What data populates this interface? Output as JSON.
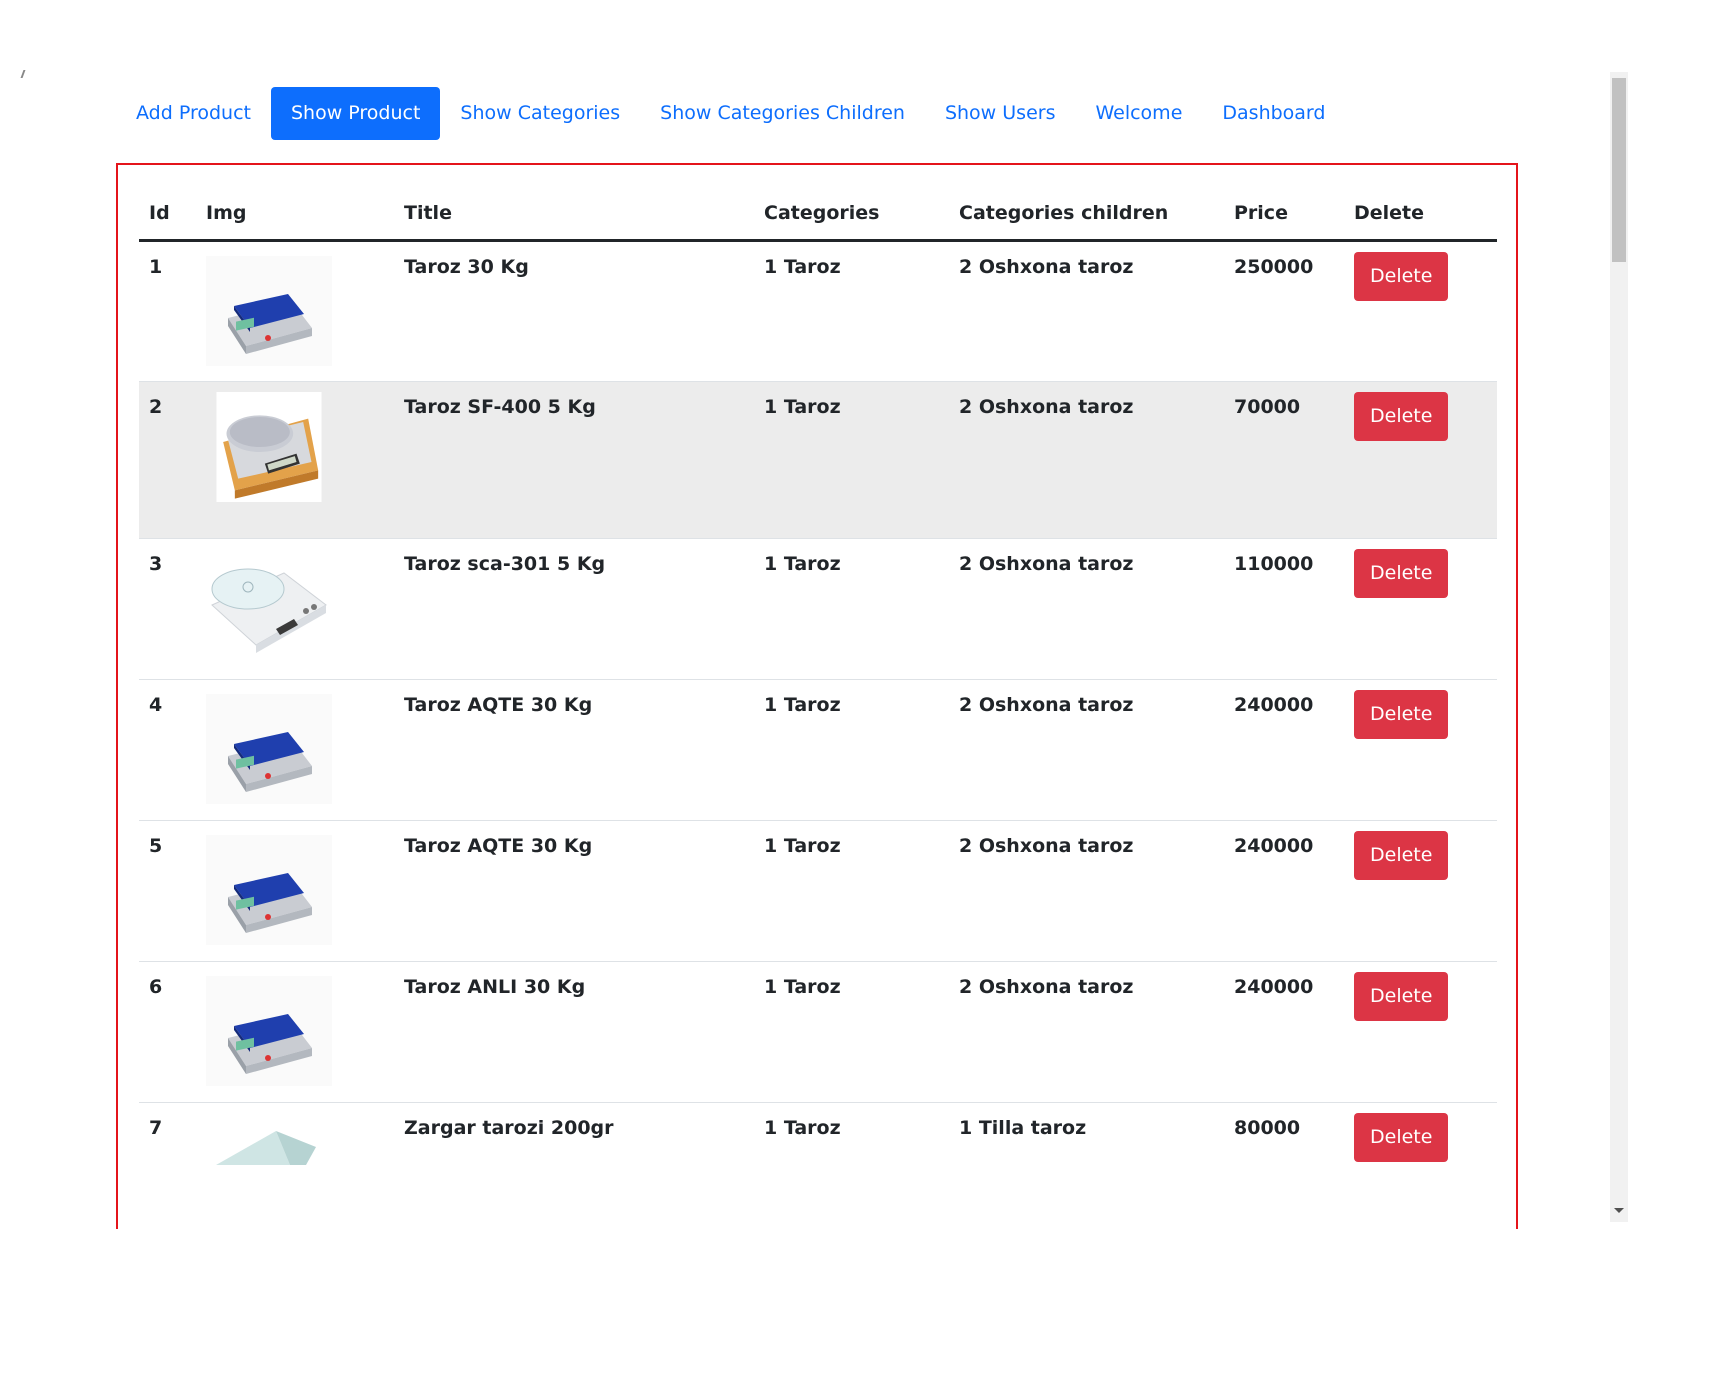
{
  "nav": {
    "items": [
      {
        "label": "Add Product",
        "active": false
      },
      {
        "label": "Show Product",
        "active": true
      },
      {
        "label": "Show Categories",
        "active": false
      },
      {
        "label": "Show Categories Children",
        "active": false
      },
      {
        "label": "Show Users",
        "active": false
      },
      {
        "label": "Welcome",
        "active": false
      },
      {
        "label": "Dashboard",
        "active": false
      }
    ]
  },
  "table": {
    "headers": {
      "id": "Id",
      "img": "Img",
      "title": "Title",
      "categories": "Categories",
      "children": "Categories children",
      "price": "Price",
      "delete": "Delete"
    },
    "rows": [
      {
        "id": "1",
        "img": "blue-platform-scale",
        "title": "Taroz 30 Kg",
        "categories": "1 Taroz",
        "children": "2 Oshxona taroz",
        "price": "250000",
        "action": "Delete"
      },
      {
        "id": "2",
        "img": "silver-kitchen-scale",
        "title": "Taroz SF-400 5 Kg",
        "categories": "1 Taroz",
        "children": "2 Oshxona taroz",
        "price": "70000",
        "action": "Delete"
      },
      {
        "id": "3",
        "img": "white-glass-scale",
        "title": "Taroz sca-301 5 Kg",
        "categories": "1 Taroz",
        "children": "2 Oshxona taroz",
        "price": "110000",
        "action": "Delete"
      },
      {
        "id": "4",
        "img": "blue-platform-scale",
        "title": "Taroz AQTE 30 Kg",
        "categories": "1 Taroz",
        "children": "2 Oshxona taroz",
        "price": "240000",
        "action": "Delete"
      },
      {
        "id": "5",
        "img": "blue-platform-scale",
        "title": "Taroz AQTE 30 Kg",
        "categories": "1 Taroz",
        "children": "2 Oshxona taroz",
        "price": "240000",
        "action": "Delete"
      },
      {
        "id": "6",
        "img": "blue-platform-scale",
        "title": "Taroz ANLI 30 Kg",
        "categories": "1 Taroz",
        "children": "2 Oshxona taroz",
        "price": "240000",
        "action": "Delete"
      },
      {
        "id": "7",
        "img": "jewelry-scale",
        "title": "Zargar tarozi 200gr",
        "categories": "1 Taroz",
        "children": "1 Tilla taroz",
        "price": "80000",
        "action": "Delete"
      }
    ]
  },
  "colors": {
    "primary": "#0d6efd",
    "danger": "#dc3545",
    "frame": "#e4141b"
  }
}
